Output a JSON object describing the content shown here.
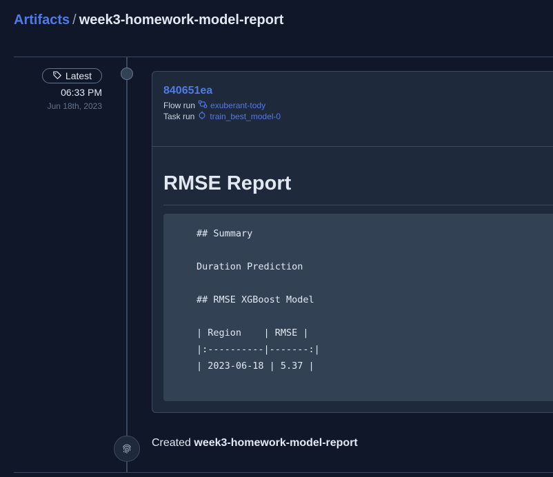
{
  "breadcrumb": {
    "root": "Artifacts",
    "separator": "/",
    "current": "week3-homework-model-report"
  },
  "version": {
    "tag": "Latest",
    "time": "06:33 PM",
    "date": "Jun 18th, 2023"
  },
  "artifact": {
    "id": "840651ea",
    "flow_run_label": "Flow run",
    "flow_run_name": "exuberant-tody",
    "task_run_label": "Task run",
    "task_run_name": "train_best_model-0",
    "report_title": "RMSE Report",
    "code_lines": [
      "## Summary",
      "",
      "Duration Prediction",
      "",
      "## RMSE XGBoost Model",
      "",
      "| Region    | RMSE |",
      "|:----------|-------:|",
      "| 2023-06-18 | 5.37 |"
    ]
  },
  "created": {
    "prefix": "Created",
    "name": "week3-homework-model-report"
  },
  "colors": {
    "background": "#0f1729",
    "card": "#1e293b",
    "code_block": "#334155",
    "accent": "#4f7be8",
    "border": "#3b4a60"
  },
  "icons": {
    "tag": "tag-icon",
    "flow_run": "flow-run-icon",
    "task_run": "task-run-icon",
    "created": "fingerprint-icon"
  }
}
